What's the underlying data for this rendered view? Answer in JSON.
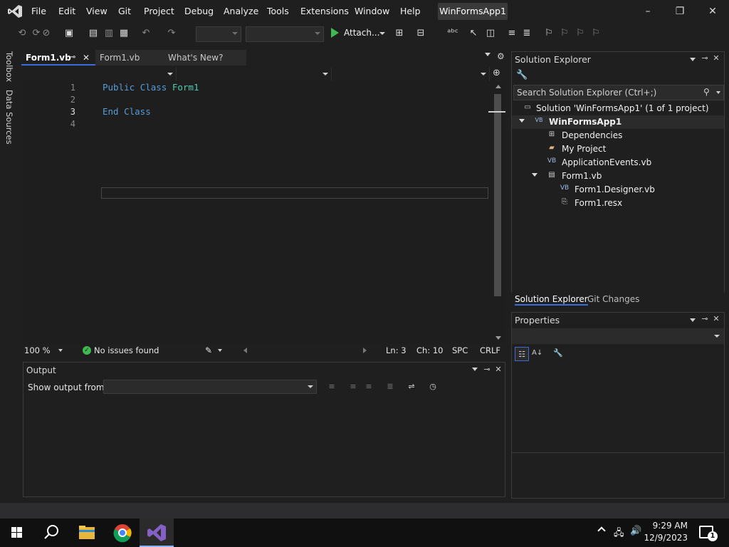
{
  "menu": {
    "items": [
      "File",
      "Edit",
      "View",
      "Git",
      "Project",
      "Debug",
      "Analyze",
      "Tools",
      "Extensions",
      "Window",
      "Help"
    ],
    "solution_badge": "WinFormsApp1"
  },
  "window_controls": {
    "minimize": "–",
    "restore": "❐",
    "close": "✕"
  },
  "toolbar": {
    "attach_label": "Attach..."
  },
  "side_rail": {
    "toolbox": "Toolbox",
    "data_sources": "Data Sources"
  },
  "doc_tabs": [
    {
      "label": "Form1.vb",
      "active": true
    },
    {
      "label": "Form1.vb",
      "active": false
    },
    {
      "label": "What's New?",
      "active": false
    }
  ],
  "editor": {
    "lines": [
      {
        "no": "1",
        "text": "Public Class Form1"
      },
      {
        "no": "2",
        "text": ""
      },
      {
        "no": "3",
        "text": "End Class"
      },
      {
        "no": "4",
        "text": ""
      }
    ],
    "keyword_public": "Public",
    "keyword_class": "Class",
    "type_name": "Form1",
    "keyword_end": "End",
    "keyword_class2": "Class"
  },
  "editor_status": {
    "zoom": "100 %",
    "issues": "No issues found",
    "line": "Ln: 3",
    "col": "Ch: 10",
    "whitespace": "SPC",
    "line_endings": "CRLF"
  },
  "output": {
    "title": "Output",
    "show_from_label": "Show output from:",
    "source_value": ""
  },
  "solution_explorer": {
    "title": "Solution Explorer",
    "search_placeholder": "Search Solution Explorer (Ctrl+;)",
    "tree": [
      {
        "label": "Solution 'WinFormsApp1' (1 of 1 project)",
        "icon": "solution-icon"
      },
      {
        "label": "WinFormsApp1",
        "icon": "vb-project-icon"
      },
      {
        "label": "Dependencies",
        "icon": "dependencies-icon"
      },
      {
        "label": "My Project",
        "icon": "folder-icon"
      },
      {
        "label": "ApplicationEvents.vb",
        "icon": "vb-file-icon"
      },
      {
        "label": "Form1.vb",
        "icon": "form-icon"
      },
      {
        "label": "Form1.Designer.vb",
        "icon": "vb-file-icon"
      },
      {
        "label": "Form1.resx",
        "icon": "resx-icon"
      }
    ],
    "tab_solution": "Solution Explorer",
    "tab_git": "Git Changes"
  },
  "properties": {
    "title": "Properties"
  },
  "taskbar": {
    "time": "9:29 AM",
    "date": "12/9/2023",
    "notification_count": "1"
  },
  "colors": {
    "accent": "#3a6dd8",
    "keyword": "#569cd6",
    "type": "#4ec9b0",
    "vs_purple": "#8661c5",
    "success": "#3fb950"
  }
}
